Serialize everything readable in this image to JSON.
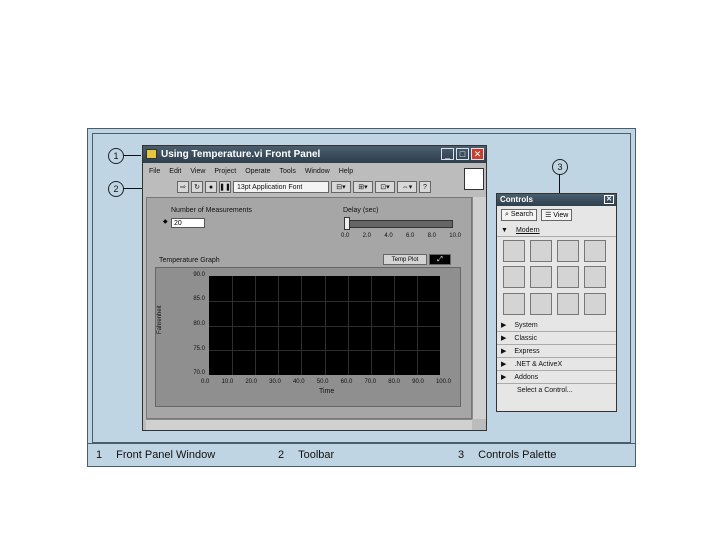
{
  "window": {
    "title": "Using Temperature.vi Front Panel",
    "menu": [
      "File",
      "Edit",
      "View",
      "Project",
      "Operate",
      "Tools",
      "Window",
      "Help"
    ],
    "font_selector": "13pt Application Font"
  },
  "panel": {
    "number_label": "Number of Measurements",
    "number_value": "20",
    "delay_label": "Delay (sec)",
    "delay_ticks": [
      "0.0",
      "2.0",
      "4.0",
      "6.0",
      "8.0",
      "10.0"
    ],
    "graph_label": "Temperature Graph",
    "plot_legend": "Temp Plot",
    "y_axis_label": "Fahrenheit",
    "x_axis_label": "Time",
    "y_ticks": [
      "90.0",
      "85.0",
      "80.0",
      "75.0",
      "70.0"
    ],
    "x_ticks": [
      "0.0",
      "10.0",
      "20.0",
      "30.0",
      "40.0",
      "50.0",
      "60.0",
      "70.0",
      "80.0",
      "90.0",
      "100.0"
    ]
  },
  "palette": {
    "title": "Controls",
    "search_label": "Search",
    "view_label": "View",
    "expanded_category": "Modern",
    "categories": [
      "System",
      "Classic",
      "Express",
      ".NET & ActiveX",
      "Addons"
    ],
    "select_control": "Select a Control..."
  },
  "callouts": [
    "1",
    "2",
    "3"
  ],
  "legend": [
    {
      "num": "1",
      "text": "Front Panel Window"
    },
    {
      "num": "2",
      "text": "Toolbar"
    },
    {
      "num": "3",
      "text": "Controls Palette"
    }
  ]
}
